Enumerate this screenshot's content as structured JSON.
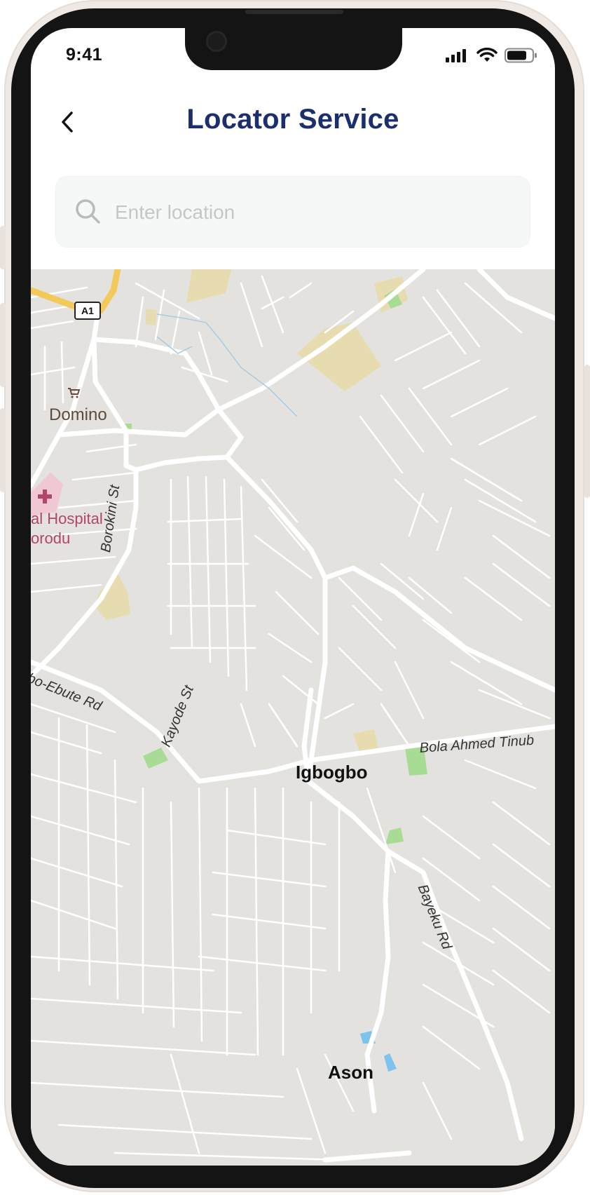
{
  "status_bar": {
    "time": "9:41"
  },
  "header": {
    "title": "Locator Service",
    "back_label": "Back"
  },
  "search": {
    "placeholder": "Enter location",
    "value": ""
  },
  "map": {
    "labels": {
      "route_marker": "A1",
      "domino": "Domino",
      "hospital_line1": "al Hospital",
      "hospital_line2": "orodu",
      "borokini": "Borokini St",
      "ebute": "bo-Ebute Rd",
      "kayode": "Kayode St",
      "bola": "Bola Ahmed Tinub",
      "igbogbo": "Igbogbo",
      "bayeku": "Bayeku Rd",
      "ason": "Ason"
    }
  },
  "colors": {
    "title": "#1b2f6e",
    "map_background": "#e4e2df",
    "road": "#ffffff",
    "highway": "#f3c95a",
    "park": "#a8dc94",
    "landuse": "#e6dcaf",
    "hospital": "#b3456d",
    "water": "#7cc4ee"
  }
}
